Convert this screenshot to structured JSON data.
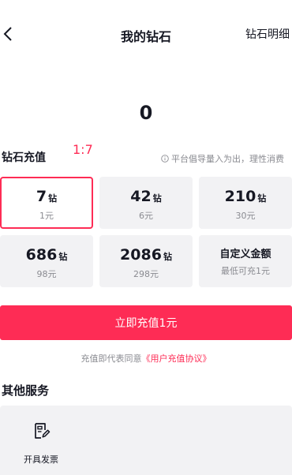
{
  "header": {
    "title": "我的钻石",
    "detail_label": "钻石明细"
  },
  "balance": "0",
  "recharge": {
    "title": "钻石充值",
    "ratio": "1:7",
    "notice": "平台倡导量入为出，理性消费",
    "options": [
      {
        "amount": "7",
        "unit": "钻",
        "price": "1元"
      },
      {
        "amount": "42",
        "unit": "钻",
        "price": "6元"
      },
      {
        "amount": "210",
        "unit": "钻",
        "price": "30元"
      },
      {
        "amount": "686",
        "unit": "钻",
        "price": "98元"
      },
      {
        "amount": "2086",
        "unit": "钻",
        "price": "298元"
      }
    ],
    "custom": {
      "label": "自定义金额",
      "hint": "最低可充1元"
    },
    "selected_index": 0
  },
  "cta_label": "立即充值1元",
  "agreement": {
    "prefix": "充值即代表同意",
    "link": "《用户充值协议》"
  },
  "other_services": {
    "title": "其他服务",
    "items": [
      {
        "label": "开具发票",
        "icon": "invoice-icon"
      }
    ]
  },
  "colors": {
    "accent": "#fe2c55",
    "card_bg": "#f2f2f4",
    "muted_text": "#8a8b91"
  }
}
